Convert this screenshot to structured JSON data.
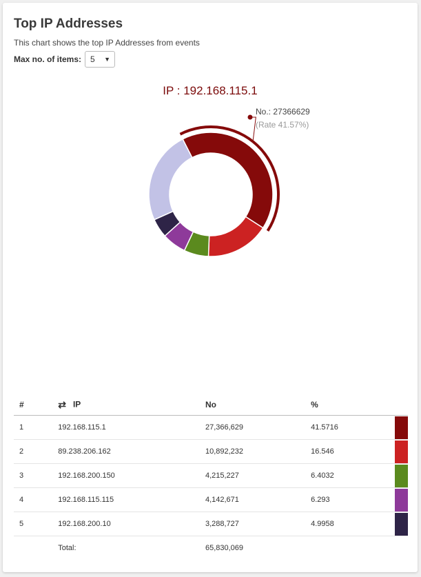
{
  "header": {
    "title": "Top IP Addresses",
    "subtitle": "This chart shows the top IP Addresses from events",
    "max_label": "Max no. of items:",
    "max_value": "5"
  },
  "highlight": {
    "heading": "IP : 192.168.115.1",
    "no_text": "No.: 27366629",
    "rate_text": "(Rate 41.57%)"
  },
  "table": {
    "headers": {
      "num": "#",
      "ip": "IP",
      "no": "No",
      "pct": "%"
    },
    "sort_icon": "swap-arrows-icon",
    "rows": [
      {
        "num": "1",
        "ip": "192.168.115.1",
        "no": "27,366,629",
        "pct": "41.5716",
        "color": "#850a0a"
      },
      {
        "num": "2",
        "ip": "89.238.206.162",
        "no": "10,892,232",
        "pct": "16.546",
        "color": "#cc2222"
      },
      {
        "num": "3",
        "ip": "192.168.200.150",
        "no": "4,215,227",
        "pct": "6.4032",
        "color": "#5b8a1e"
      },
      {
        "num": "4",
        "ip": "192.168.115.115",
        "no": "4,142,671",
        "pct": "6.293",
        "color": "#8e3a9a"
      },
      {
        "num": "5",
        "ip": "192.168.200.10",
        "no": "3,288,727",
        "pct": "4.9958",
        "color": "#2e2447"
      }
    ],
    "total_label": "Total:",
    "total_value": "65,830,069"
  },
  "chart_data": {
    "type": "pie",
    "labels": [
      "192.168.115.1",
      "89.238.206.162",
      "192.168.200.150",
      "192.168.115.115",
      "192.168.200.10",
      ""
    ],
    "values": [
      41.5716,
      16.546,
      6.4032,
      6.293,
      4.9958,
      24.1904
    ],
    "colors": [
      "#850a0a",
      "#cc2222",
      "#5b8a1e",
      "#8e3a9a",
      "#2e2447",
      "#c2c2e6"
    ],
    "highlighted_index": 0
  }
}
